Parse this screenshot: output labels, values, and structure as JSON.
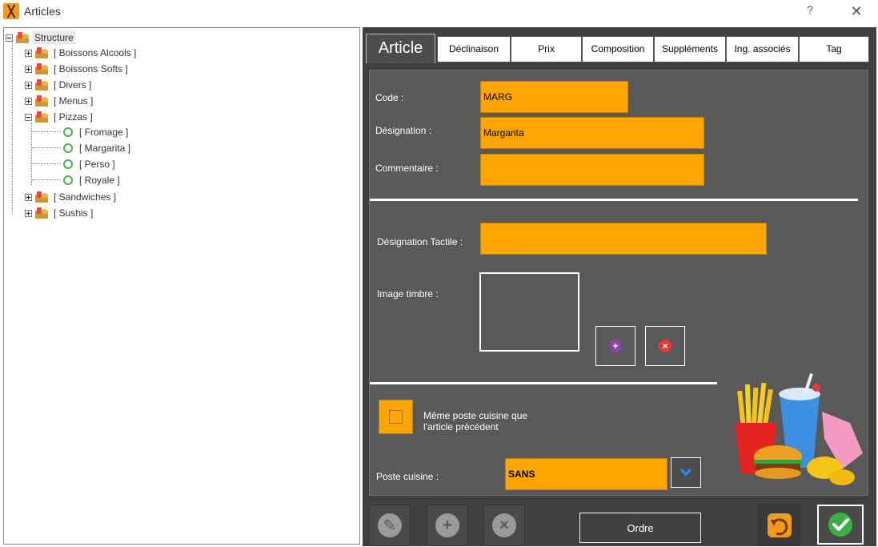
{
  "window": {
    "title": "Articles",
    "help_label": "?",
    "close_label": "✕"
  },
  "tree": {
    "root_label": "Structure",
    "categories": [
      {
        "label": "[ Boissons Alcools ]",
        "expanded": false
      },
      {
        "label": "[ Boissons Softs ]",
        "expanded": false
      },
      {
        "label": "[ Divers ]",
        "expanded": false
      },
      {
        "label": "[ Menus ]",
        "expanded": false
      },
      {
        "label": "[ Pizzas ]",
        "expanded": true,
        "children": [
          "[ Fromage ]",
          "[ Margarita ]",
          "[ Perso ]",
          "[ Royale ]"
        ]
      },
      {
        "label": "[ Sandwiches ]",
        "expanded": false
      },
      {
        "label": "[ Sushis ]",
        "expanded": false
      }
    ]
  },
  "tabs": [
    {
      "label": "Article",
      "active": true
    },
    {
      "label": "Déclinaison",
      "active": false
    },
    {
      "label": "Prix",
      "active": false
    },
    {
      "label": "Composition",
      "active": false
    },
    {
      "label": "Suppléments",
      "active": false
    },
    {
      "label": "Ing. associés",
      "active": false
    },
    {
      "label": "Tag",
      "active": false
    }
  ],
  "form": {
    "code_label": "Code :",
    "code_value": "MARG",
    "designation_label": "Désignation :",
    "designation_value": "Margarita",
    "commentaire_label": "Commentaire :",
    "commentaire_value": "",
    "designation_tactile_label": "Désignation Tactile :",
    "designation_tactile_value": "",
    "image_label": "Image timbre :",
    "same_station_label_line1": "Même poste cuisine que",
    "same_station_label_line2": "l'article précédent",
    "same_station_checked": false,
    "poste_label": "Poste cuisine :",
    "poste_value": "SANS"
  },
  "toolbar": {
    "ordre_label": "Ordre"
  },
  "colors": {
    "field_bg": "#ffa500",
    "panel_bg": "#404040",
    "content_bg": "#595959",
    "add_icon": "#8e44ad",
    "remove_icon": "#e53935",
    "ok_icon": "#3cb043",
    "chevron": "#1e90ff"
  },
  "icons": {
    "add_image": "plus-circle-icon",
    "remove_image": "x-circle-icon",
    "edit": "edit-icon",
    "add": "plus-icon",
    "delete": "delete-icon",
    "undo": "undo-icon",
    "confirm": "check-icon"
  }
}
